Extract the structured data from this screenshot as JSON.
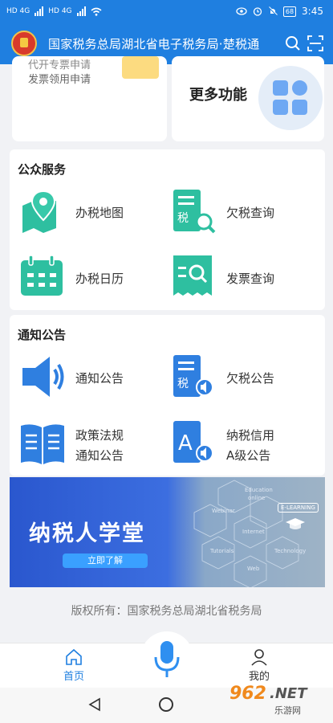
{
  "status_bar": {
    "carrier_1": "HD 4G",
    "carrier_2": "HD 4G",
    "battery": "68",
    "time": "3:45"
  },
  "header": {
    "title": "国家税务总局湖北省电子税务局·楚税通"
  },
  "top_cards": {
    "left_items": [
      "代开专票申请",
      "发票领用申请"
    ],
    "more_functions": "更多功能"
  },
  "public_service": {
    "title": "公众服务",
    "items": [
      {
        "label": "办税地图",
        "icon": "map-icon"
      },
      {
        "label": "欠税查询",
        "icon": "tax-search-icon"
      },
      {
        "label": "办税日历",
        "icon": "calendar-icon"
      },
      {
        "label": "发票查询",
        "icon": "invoice-search-icon"
      }
    ]
  },
  "notice": {
    "title": "通知公告",
    "items": [
      {
        "label": "通知公告",
        "icon": "speaker-icon"
      },
      {
        "label": "欠税公告",
        "icon": "tax-announce-icon"
      },
      {
        "label_line1": "政策法规",
        "label_line2": "通知公告",
        "icon": "book-icon"
      },
      {
        "label_line1": "纳税信用",
        "label_line2": "A级公告",
        "icon": "credit-a-icon"
      }
    ]
  },
  "banner": {
    "title": "纳税人学堂",
    "button": "立即了解",
    "hex_labels": [
      "Education",
      "online",
      "Webinar",
      "E-LEARNING",
      "Internet",
      "Tutorials",
      "Technology",
      "Web"
    ]
  },
  "footer": {
    "copyright": "版权所有：国家税务总局湖北省税务局"
  },
  "tabbar": {
    "home": "首页",
    "me": "我的"
  },
  "watermark": {
    "num": "962",
    "net": ".NET",
    "cn": "乐游网"
  },
  "colors": {
    "brand": "#1f7fe0",
    "icon_teal": "#2ebfa0",
    "icon_blue": "#2f7fe0"
  }
}
